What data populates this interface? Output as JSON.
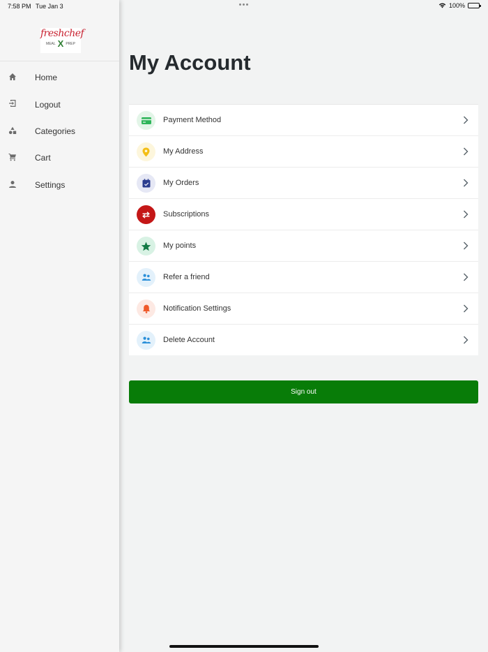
{
  "status": {
    "time": "7:58 PM",
    "date": "Tue Jan 3",
    "battery": "100%"
  },
  "sidebar": {
    "logo": {
      "brand": "freshchef",
      "left": "MEAL",
      "mark": "X",
      "right": "PREP"
    },
    "items": [
      {
        "label": "Home",
        "icon": "home-icon"
      },
      {
        "label": "Logout",
        "icon": "logout-icon"
      },
      {
        "label": "Categories",
        "icon": "categories-icon"
      },
      {
        "label": "Cart",
        "icon": "cart-icon"
      },
      {
        "label": "Settings",
        "icon": "person-icon"
      }
    ]
  },
  "main": {
    "title": "My Account",
    "rows": [
      {
        "label": "Payment Method",
        "icon": "credit-card-icon",
        "bg": "#e3f5e8",
        "fg": "#2db559"
      },
      {
        "label": "My Address",
        "icon": "location-pin-icon",
        "bg": "#fdf6dc",
        "fg": "#f3be16"
      },
      {
        "label": "My Orders",
        "icon": "calendar-check-icon",
        "bg": "#e6e8f5",
        "fg": "#2b3d8f"
      },
      {
        "label": "Subscriptions",
        "icon": "repeat-icon",
        "bg": "#c41717",
        "fg": "#ffffff"
      },
      {
        "label": "My points",
        "icon": "star-icon",
        "bg": "#d8f2e4",
        "fg": "#127a45"
      },
      {
        "label": "Refer a friend",
        "icon": "users-icon",
        "bg": "#e3f1fb",
        "fg": "#2a8fd9"
      },
      {
        "label": "Notification Settings",
        "icon": "bell-icon",
        "bg": "#fde9e3",
        "fg": "#ef5a2a"
      },
      {
        "label": "Delete Account",
        "icon": "users-icon",
        "bg": "#e3f1fb",
        "fg": "#2a8fd9"
      }
    ],
    "signout_label": "Sign out",
    "accent": "#087c08"
  }
}
